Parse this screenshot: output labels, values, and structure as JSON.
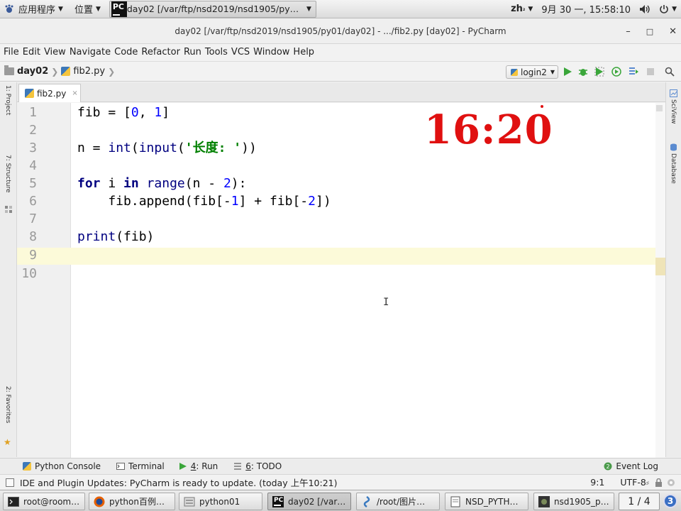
{
  "system_panel": {
    "apps_menu": "应用程序",
    "places_menu": "位置",
    "active_task": "day02 [/var/ftp/nsd2019/nsd1905/py…",
    "input_method": "zh",
    "datetime": "9月 30 一, 15:58:10"
  },
  "window": {
    "title": "day02 [/var/ftp/nsd2019/nsd1905/py01/day02] - .../fib2.py [day02] - PyCharm",
    "minimize": "–",
    "maximize": "□",
    "close": "✕"
  },
  "menu": [
    "File",
    "Edit",
    "View",
    "Navigate",
    "Code",
    "Refactor",
    "Run",
    "Tools",
    "VCS",
    "Window",
    "Help"
  ],
  "navbar": {
    "project": "day02",
    "file": "fib2.py",
    "run_config": "login2"
  },
  "left_strip": {
    "project_label": "1: Project",
    "structure_label": "7: Structure",
    "favorites_label": "2: Favorites"
  },
  "right_strip": {
    "scview_label": "SciView",
    "database_label": "Database"
  },
  "tab": {
    "label": "fib2.py",
    "close": "×"
  },
  "editor": {
    "line_numbers": [
      "1",
      "2",
      "3",
      "4",
      "5",
      "6",
      "7",
      "8",
      "9",
      "10"
    ]
  },
  "overlay_time": "16:20",
  "tool_windows": {
    "python_console": "Python Console",
    "terminal": "Terminal",
    "run_num": "4",
    "run": ": Run",
    "todo_num": "6",
    "todo": ": TODO",
    "event_log": "Event Log"
  },
  "status": {
    "message": "IDE and Plugin Updates: PyCharm is ready to update. (today 上午10:21)",
    "position": "9:1",
    "encoding": "UTF-8"
  },
  "taskbar": {
    "tasks": [
      "root@room…",
      "python百例…",
      "python01",
      "day02 [/var…",
      "/root/图片…",
      "NSD_PYTH…",
      "nsd1905_p…"
    ],
    "workspace": "1 / 4",
    "badge": "3"
  }
}
